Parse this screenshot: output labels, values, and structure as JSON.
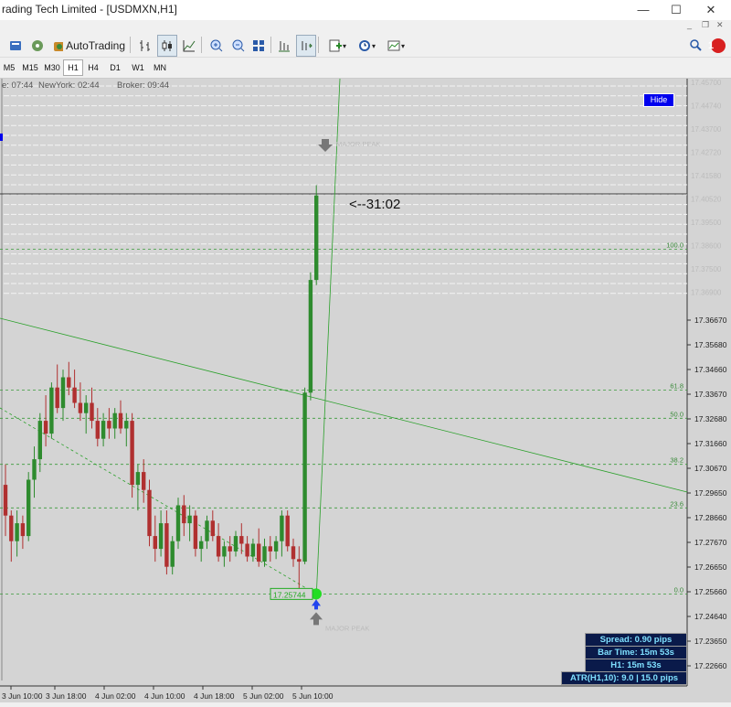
{
  "window": {
    "title": "rading Tech Limited - [USDMXN,H1]",
    "min": "—",
    "max": "☐",
    "close": "✕"
  },
  "toolbar": {
    "autotrading_label": "AutoTrading",
    "notification_count": "1"
  },
  "timeframes": [
    "M5",
    "M15",
    "M30",
    "H1",
    "H4",
    "D1",
    "W1",
    "MN"
  ],
  "active_timeframe": "H1",
  "clocks": {
    "local": "e: 07:44",
    "newyork": "NewYork: 02:44",
    "broker": "Broker: 09:44"
  },
  "hide_label": "Hide",
  "countdown": "<--31:02",
  "price_marker": "17.25744",
  "labels": {
    "major_peak": "MAJOR PEAK",
    "major_low": "MAJOR PEAK"
  },
  "fib": [
    {
      "level": "100.0",
      "price": 17.392
    },
    {
      "level": "61.8",
      "price": 17.337
    },
    {
      "level": "50.0",
      "price": 17.326
    },
    {
      "level": "38.2",
      "price": 17.308
    },
    {
      "level": "23.6",
      "price": 17.291
    },
    {
      "level": "0.0",
      "price": 17.2574
    }
  ],
  "info": {
    "spread": "Spread: 0.90 pips",
    "bar_time": "Bar Time: 15m 53s",
    "h1": "H1:  15m 53s",
    "atr": "ATR(H1,10): 9.0  |  15.0 pips"
  },
  "colors": {
    "bull": "#2e8b2e",
    "bear": "#b03030",
    "accent": "#0000ee"
  },
  "chart_data": {
    "type": "candlestick",
    "symbol": "USDMXN",
    "timeframe": "H1",
    "ylim": [
      17.2236,
      17.4579
    ],
    "y_ticks": [
      "17.36670",
      "17.35680",
      "17.34660",
      "17.33670",
      "17.32680",
      "17.31660",
      "17.30670",
      "17.29650",
      "17.28660",
      "17.27670",
      "17.26650",
      "17.25660",
      "17.24640",
      "17.23650",
      "17.22660"
    ],
    "upper_ticks": [
      "17.45700",
      "17.44740",
      "17.43700",
      "17.42720",
      "17.41580",
      "17.40520",
      "17.39500",
      "17.38600",
      "17.37500",
      "17.36900"
    ],
    "x_ticks": [
      "3 Jun 10:00",
      "3 Jun 18:00",
      "4 Jun 02:00",
      "4 Jun 10:00",
      "4 Jun 18:00",
      "5 Jun 02:00",
      "5 Jun 10:00"
    ],
    "candles": [
      [
        17.3,
        17.308,
        17.28,
        17.288
      ],
      [
        17.288,
        17.29,
        17.27,
        17.278
      ],
      [
        17.278,
        17.29,
        17.272,
        17.285
      ],
      [
        17.285,
        17.288,
        17.275,
        17.28
      ],
      [
        17.28,
        17.305,
        17.278,
        17.302
      ],
      [
        17.302,
        17.315,
        17.295,
        17.31
      ],
      [
        17.31,
        17.328,
        17.305,
        17.325
      ],
      [
        17.325,
        17.335,
        17.315,
        17.32
      ],
      [
        17.32,
        17.34,
        17.318,
        17.338
      ],
      [
        17.338,
        17.347,
        17.328,
        17.33
      ],
      [
        17.33,
        17.345,
        17.325,
        17.342
      ],
      [
        17.342,
        17.348,
        17.335,
        17.338
      ],
      [
        17.338,
        17.345,
        17.33,
        17.332
      ],
      [
        17.332,
        17.34,
        17.325,
        17.328
      ],
      [
        17.328,
        17.335,
        17.32,
        17.332
      ],
      [
        17.332,
        17.338,
        17.322,
        17.325
      ],
      [
        17.325,
        17.33,
        17.315,
        17.318
      ],
      [
        17.318,
        17.328,
        17.315,
        17.325
      ],
      [
        17.325,
        17.33,
        17.318,
        17.322
      ],
      [
        17.322,
        17.33,
        17.318,
        17.328
      ],
      [
        17.328,
        17.333,
        17.32,
        17.322
      ],
      [
        17.322,
        17.328,
        17.315,
        17.325
      ],
      [
        17.325,
        17.328,
        17.295,
        17.3
      ],
      [
        17.3,
        17.308,
        17.29,
        17.305
      ],
      [
        17.305,
        17.31,
        17.293,
        17.298
      ],
      [
        17.298,
        17.302,
        17.276,
        17.28
      ],
      [
        17.28,
        17.288,
        17.27,
        17.275
      ],
      [
        17.275,
        17.29,
        17.272,
        17.285
      ],
      [
        17.285,
        17.29,
        17.265,
        17.268
      ],
      [
        17.268,
        17.28,
        17.265,
        17.278
      ],
      [
        17.278,
        17.295,
        17.275,
        17.292
      ],
      [
        17.292,
        17.296,
        17.28,
        17.285
      ],
      [
        17.285,
        17.292,
        17.278,
        17.288
      ],
      [
        17.288,
        17.29,
        17.272,
        17.275
      ],
      [
        17.275,
        17.28,
        17.27,
        17.278
      ],
      [
        17.278,
        17.288,
        17.275,
        17.286
      ],
      [
        17.286,
        17.29,
        17.278,
        17.28
      ],
      [
        17.28,
        17.285,
        17.27,
        17.272
      ],
      [
        17.272,
        17.278,
        17.268,
        17.276
      ],
      [
        17.276,
        17.28,
        17.27,
        17.274
      ],
      [
        17.274,
        17.282,
        17.272,
        17.28
      ],
      [
        17.28,
        17.285,
        17.273,
        17.277
      ],
      [
        17.277,
        17.28,
        17.27,
        17.272
      ],
      [
        17.272,
        17.279,
        17.27,
        17.277
      ],
      [
        17.277,
        17.283,
        17.268,
        17.27
      ],
      [
        17.27,
        17.279,
        17.268,
        17.276
      ],
      [
        17.276,
        17.28,
        17.27,
        17.274
      ],
      [
        17.274,
        17.28,
        17.271,
        17.278
      ],
      [
        17.278,
        17.29,
        17.272,
        17.288
      ],
      [
        17.288,
        17.29,
        17.274,
        17.276
      ],
      [
        17.276,
        17.279,
        17.268,
        17.271
      ],
      [
        17.271,
        17.276,
        17.257,
        17.27
      ],
      [
        17.27,
        17.338,
        17.269,
        17.336
      ],
      [
        17.336,
        17.383,
        17.333,
        17.38
      ],
      [
        17.38,
        17.417,
        17.378,
        17.413
      ]
    ]
  }
}
